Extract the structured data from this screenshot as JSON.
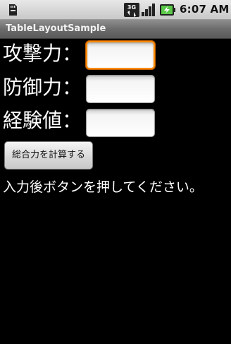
{
  "status_bar": {
    "time": "6:07 AM",
    "network_label": "3G",
    "icons": [
      "sd-card-icon",
      "3g-icon",
      "signal-icon",
      "battery-charging-icon"
    ]
  },
  "app": {
    "title": "TableLayoutSample"
  },
  "form": {
    "attack_label": "攻撃力：",
    "defense_label": "防御力：",
    "experience_label": "経験値：",
    "attack_value": "",
    "defense_value": "",
    "experience_value": "",
    "button_label": "総合力を計算する",
    "message": "入力後ボタンを押してください。"
  },
  "colors": {
    "focus_border": "#ff8a00",
    "background": "#000000",
    "title_bar": "#6c6c6c",
    "status_bar": "#d0d0d0"
  }
}
